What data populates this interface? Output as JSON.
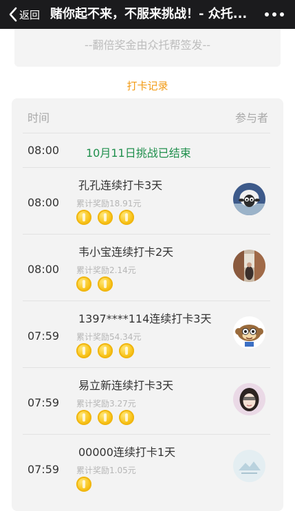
{
  "nav": {
    "back_label": "返回",
    "title": "赌你起不来，不服来挑战！- 众托...",
    "more_icon": "more-dots-icon"
  },
  "topcard": {
    "note": "--翻倍奖金由众托帮签发--"
  },
  "records_link": "打卡记录",
  "table": {
    "col_time": "时间",
    "col_participant": "参与者",
    "ended_row": {
      "time": "08:00",
      "text": "10月11日挑战已结束"
    },
    "rows": [
      {
        "time": "08:00",
        "headline": "孔孔连续打卡3天",
        "reward": "累计奖励18.91元",
        "coins": 3,
        "avatar": "sheep-avatar"
      },
      {
        "time": "08:00",
        "headline": "韦小宝连续打卡2天",
        "reward": "累计奖励2.14元",
        "coins": 2,
        "avatar": "street-photo-avatar"
      },
      {
        "time": "07:59",
        "headline": "1397****114连续打卡3天",
        "reward": "累计奖励54.34元",
        "coins": 3,
        "avatar": "cartoon-monkey-avatar"
      },
      {
        "time": "07:59",
        "headline": "易立新连续打卡3天",
        "reward": "累计奖励3.27元",
        "coins": 3,
        "avatar": "girl-photo-avatar"
      },
      {
        "time": "07:59",
        "headline": "00000连续打卡1天",
        "reward": "累计奖励1.05元",
        "coins": 1,
        "avatar": "mountain-logo-avatar"
      }
    ]
  },
  "colors": {
    "accent_orange": "#f29a13",
    "ended_green": "#1f8f4c",
    "coin_gold": "#f9c41b"
  }
}
